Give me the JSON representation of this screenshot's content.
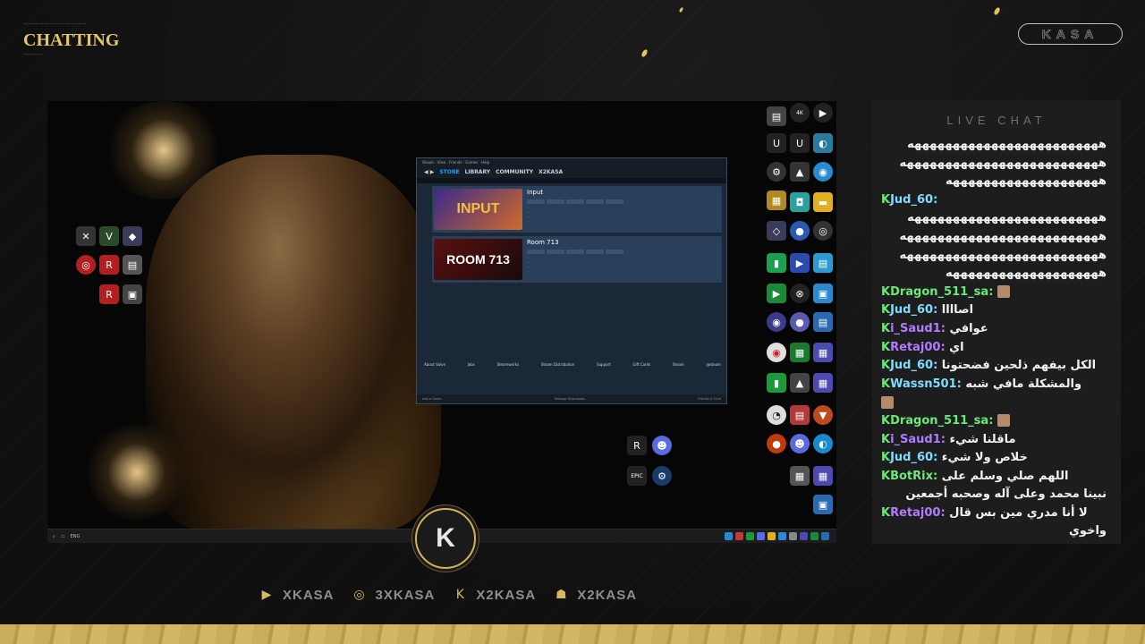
{
  "overlay": {
    "scene_label": "CHATTING",
    "brand": "KASA",
    "center_logo": "K",
    "socials": [
      {
        "icon": "youtube-icon",
        "handle": "XKASA"
      },
      {
        "icon": "instagram-icon",
        "handle": "3XKASA"
      },
      {
        "icon": "kick-icon",
        "handle": "X2KASA"
      },
      {
        "icon": "snapchat-icon",
        "handle": "X2KASA"
      }
    ],
    "accent": "#d4b25a"
  },
  "steam": {
    "nav": {
      "store": "STORE",
      "library": "LIBRARY",
      "community": "COMMUNITY",
      "user": "X2KASA"
    },
    "games": [
      {
        "name": "Input",
        "thumb": "INPUT"
      },
      {
        "name": "Room 713",
        "thumb": "ROOM 713"
      }
    ],
    "footer": [
      "About Valve",
      "Jobs",
      "Steamworks",
      "Steam Distribution",
      "Support",
      "Gift Cards",
      "Steam",
      "@steam"
    ],
    "bottom_left": "Add a Game",
    "bottom_mid": "Manage Downloads",
    "bottom_right": "Friends & Chat"
  },
  "chat": {
    "title": "LIVE CHAT",
    "lines": [
      {
        "text": "هههههههههههههههههههههههههه",
        "dir": "rtl"
      },
      {
        "text": "ههههههههههههههههههههههههههه",
        "dir": "rtl"
      },
      {
        "text": "ههههههههههههههههههههه",
        "dir": "rtl"
      },
      {
        "user": "Jud_60",
        "text": "",
        "dir": "ltr"
      },
      {
        "text": "هههههههههههههههههههههههههه",
        "dir": "rtl"
      },
      {
        "text": "ههههههههههههههههههههههههههه",
        "dir": "rtl"
      },
      {
        "text": "ههههههههههههههههههههههههههه",
        "dir": "rtl"
      },
      {
        "text": "ههههههههههههههههههههه",
        "dir": "rtl"
      },
      {
        "user": "Dragon_511_sa",
        "text": "",
        "dir": "ltr"
      },
      {
        "user": "Jud_60",
        "text": "اصاااا",
        "dir": "ltr"
      },
      {
        "user": "i_Saud1",
        "text": "عوافي",
        "dir": "ltr"
      },
      {
        "user": "Retaj00",
        "text": "اي",
        "dir": "ltr"
      },
      {
        "user": "Jud_60",
        "text": "الكل بيفهم ذلحين فضحتونا",
        "dir": "ltr"
      },
      {
        "user": "Wassn501",
        "text": "والمشكلة مافي شبه",
        "dir": "ltr"
      },
      {
        "user": "",
        "text": "",
        "dir": "ltr"
      },
      {
        "user": "Dragon_511_sa",
        "text": "",
        "dir": "ltr"
      },
      {
        "user": "i_Saud1",
        "text": "ماقلنا شيء",
        "dir": "ltr"
      },
      {
        "user": "Jud_60",
        "text": "خلاص ولا شيء",
        "dir": "ltr"
      },
      {
        "user": "BotRix",
        "text": "اللهم صلي وسلم على",
        "dir": "ltr"
      },
      {
        "text": "نبينا محمد وعلى آله وصحبه أجمعين",
        "dir": "rtl"
      },
      {
        "user": "Retaj00",
        "text": "لا أنا مدري مين بس قال",
        "dir": "ltr"
      },
      {
        "text": "واخوي",
        "dir": "rtl"
      }
    ]
  }
}
